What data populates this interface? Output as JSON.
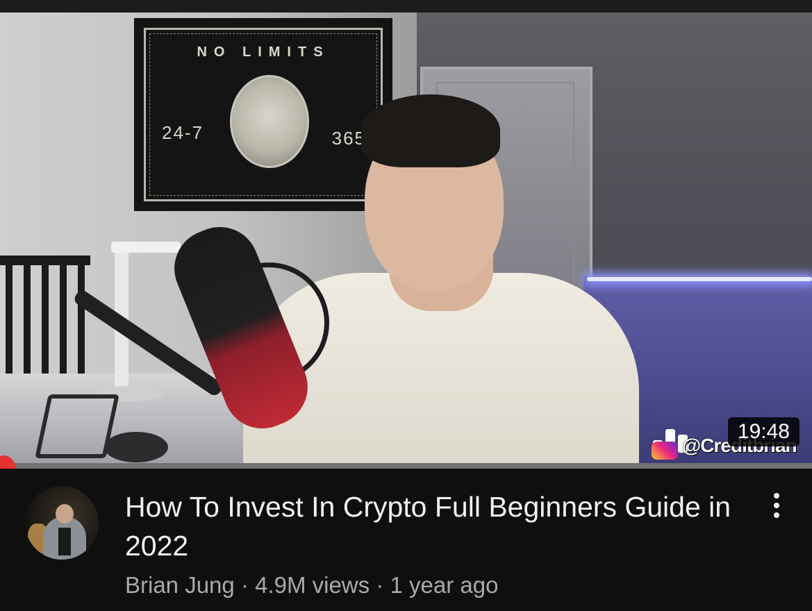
{
  "thumbnail": {
    "poster_title": "NO LIMITS",
    "poster_left": "24-7",
    "poster_right": "365",
    "watermark": "@Creditbrian",
    "duration": "19:48",
    "progress_percent": 0.5
  },
  "video": {
    "title": "How To Invest In Crypto Full Beginners Guide in 2022",
    "channel": "Brian Jung",
    "separator": " · ",
    "views": "4.9M views",
    "age": "1 year ago"
  },
  "colors": {
    "background": "#0f0f0f",
    "title": "#f1f1f1",
    "meta": "#aaaaaa",
    "progress": "#ff0000",
    "scrubber": "#e5322f"
  },
  "icons": {
    "more": "more-vert-icon",
    "watermark_logo": "bar-chart-logo-icon"
  }
}
